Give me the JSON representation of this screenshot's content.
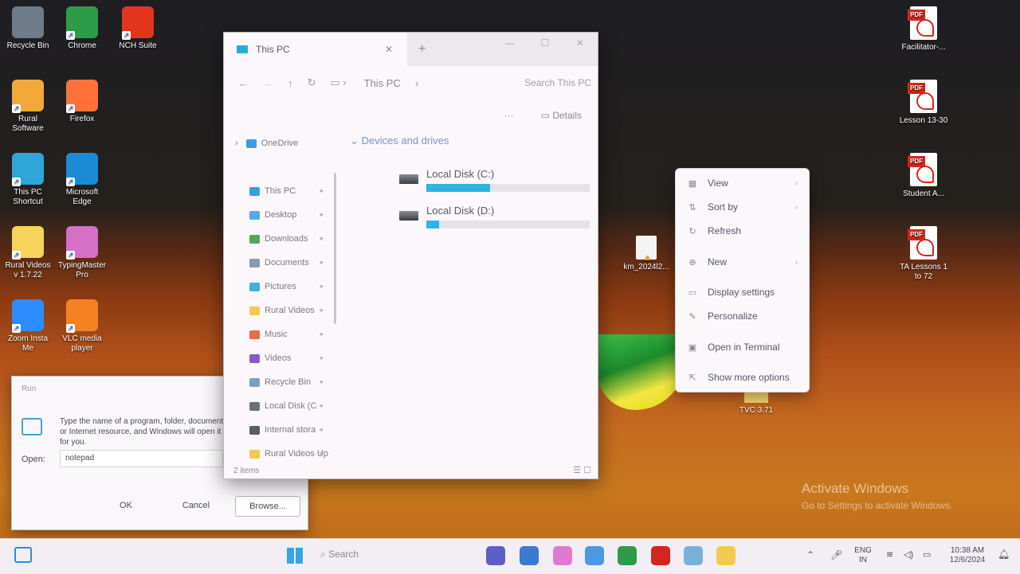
{
  "desktop": {
    "icons_left": [
      {
        "label": "Recycle Bin",
        "color": "#6d7b8a"
      },
      {
        "label": "Chrome",
        "color": "#2e9b49"
      },
      {
        "label": "NCH Suite",
        "color": "#e3351e"
      },
      {
        "label": "Rural\nSoftware",
        "color": "#f2a93a"
      },
      {
        "label": "Firefox",
        "color": "#ff7139"
      },
      {
        "label": "This PC\nShortcut",
        "color": "#2fa5d8"
      },
      {
        "label": "Microsoft\nEdge",
        "color": "#1b8bd6"
      },
      {
        "label": "Rural Videos\nv 1.7.22",
        "color": "#f6d35a"
      },
      {
        "label": "TypingMaster\nPro",
        "color": "#d66fc8"
      },
      {
        "label": "Zoom Insta\nMe",
        "color": "#2d8cff"
      },
      {
        "label": "VLC media\nplayer",
        "color": "#f58220"
      }
    ],
    "icons_right": [
      {
        "label": "Facilitator-..."
      },
      {
        "label": "Lesson 13-30"
      },
      {
        "label": "Student A..."
      },
      {
        "label": "TA Lessons 1\nto 72"
      }
    ],
    "file_km": "km_2024l2...",
    "file_tvc": "TVC 3.71",
    "watermark_line1": "Activate Windows",
    "watermark_line2": "Go to Settings to activate Windows."
  },
  "explorer": {
    "tab_title": "This PC",
    "close_tab": "✕",
    "new_tab": "+",
    "window_controls": [
      "—",
      "☐",
      "✕"
    ],
    "breadcrumb": "This PC",
    "search_placeholder": "Search This PC",
    "cmd_more": "···",
    "cmd_details": "Details",
    "nav_items": [
      {
        "label": "OneDrive",
        "color": "#3a9ee4"
      },
      {
        "label": "This PC",
        "color": "#2fa5d8"
      },
      {
        "label": "Desktop",
        "color": "#4ab0e6"
      },
      {
        "label": "Downloads",
        "color": "#5aa35a"
      },
      {
        "label": "Documents",
        "color": "#8a9bb0"
      },
      {
        "label": "Pictures",
        "color": "#3ab4d8"
      },
      {
        "label": "Rural Videos",
        "color": "#f4c94e"
      },
      {
        "label": "Music",
        "color": "#e86a4a"
      },
      {
        "label": "Videos",
        "color": "#8a5ac8"
      },
      {
        "label": "Recycle Bin",
        "color": "#7aa0c0"
      },
      {
        "label": "Local Disk (C",
        "color": "#6c7078"
      },
      {
        "label": "Internal stora",
        "color": "#5a5e66"
      },
      {
        "label": "Rural Videos Up",
        "color": "#f4c94e"
      }
    ],
    "group_header": "Devices and drives",
    "drives": [
      {
        "label": "Local Disk (C:)",
        "used_fraction": 0.39
      },
      {
        "label": "Local Disk (D:)",
        "used_fraction": 0.08
      }
    ],
    "status": "2 items"
  },
  "run_dialog": {
    "title": "Run",
    "description": "Type the name of a program, folder, document, or Internet resource, and Windows will open it for you.",
    "open_label": "Open:",
    "open_value": "notepad",
    "ok": "OK",
    "cancel": "Cancel",
    "browse": "Browse..."
  },
  "context_menu": {
    "items": [
      {
        "label": "View",
        "icon": "▦",
        "submenu": true
      },
      {
        "label": "Sort by",
        "icon": "⇅",
        "submenu": true
      },
      {
        "label": "Refresh",
        "icon": "↻",
        "submenu": false
      },
      {
        "label": "New",
        "icon": "⊕",
        "submenu": true
      },
      {
        "label": "Display settings",
        "icon": "▭",
        "submenu": false
      },
      {
        "label": "Personalize",
        "icon": "✎",
        "submenu": false
      },
      {
        "label": "Open in Terminal",
        "icon": "▣",
        "submenu": false
      },
      {
        "label": "Show more options",
        "icon": "⇱",
        "submenu": false
      }
    ]
  },
  "taskbar": {
    "search_label": "Search",
    "apps": [
      {
        "name": "teams",
        "color": "#5b5fc7"
      },
      {
        "name": "store",
        "color": "#3a7ad0"
      },
      {
        "name": "copilot",
        "color": "#e07ad0"
      },
      {
        "name": "clock",
        "color": "#4a9ae0"
      },
      {
        "name": "chrome",
        "color": "#2e9b49"
      },
      {
        "name": "acrobat",
        "color": "#d4251e"
      },
      {
        "name": "run",
        "color": "#7ab0d8"
      },
      {
        "name": "file-explorer",
        "color": "#f4c94e"
      }
    ],
    "language_line1": "ENG",
    "language_line2": "IN",
    "time": "10:38 AM",
    "date": "12/6/2024"
  }
}
